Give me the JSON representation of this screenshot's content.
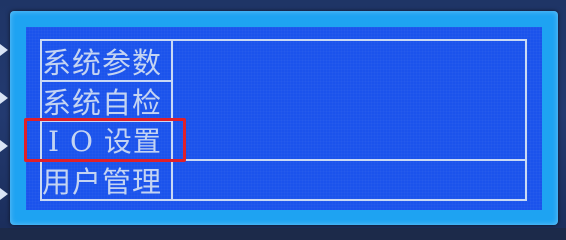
{
  "menu": {
    "items": [
      {
        "label": "系统参数"
      },
      {
        "label": "系统自检"
      },
      {
        "label": "I O 设置"
      },
      {
        "label": "用户管理"
      }
    ],
    "selected_index": 2
  },
  "colors": {
    "lcd_background": "#1b53ec",
    "text": "#c4d4f2",
    "highlight_border": "#e0202a",
    "bezel": "#1ea3f2"
  }
}
